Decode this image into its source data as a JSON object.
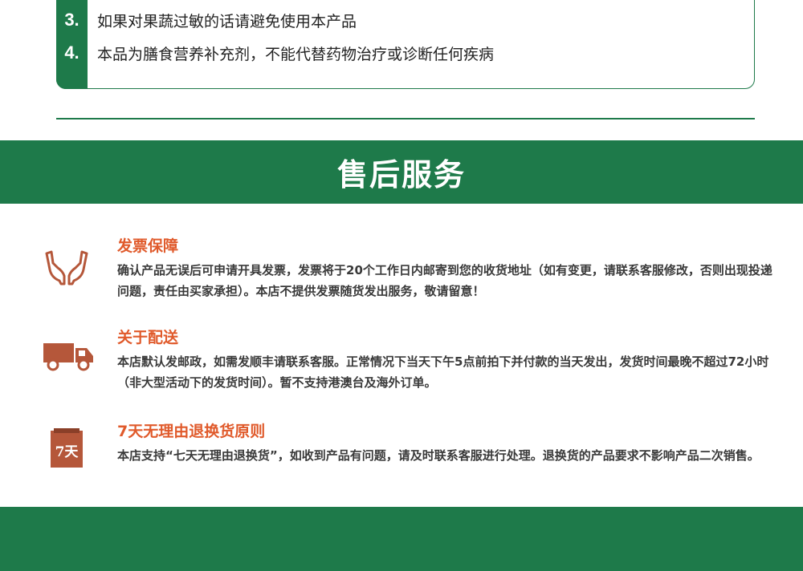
{
  "notice": {
    "items": [
      {
        "num": "3.",
        "text": "如果对果蔬过敏的话请避免使用本产品"
      },
      {
        "num": "4.",
        "text": "本品为膳食营养补充剂，不能代替药物治疗或诊断任何疾病"
      }
    ]
  },
  "banner": {
    "title": "售后服务"
  },
  "services": [
    {
      "title": "发票保障",
      "desc": "确认产品无误后可申请开具发票，发票将于20个工作日内邮寄到您的收货地址（如有变更，请联系客服修改，否则出现投递问题，责任由买家承担）。本店不提供发票随货发出服务，敬请留意！",
      "icon": "hands-icon"
    },
    {
      "title": "关于配送",
      "desc": "本店默认发邮政，如需发顺丰请联系客服。正常情况下当天下午5点前拍下并付款的当天发出，发货时间最晚不超过72小时（非大型活动下的发货时间）。暂不支持港澳台及海外订单。",
      "icon": "truck-icon"
    },
    {
      "title": "7天无理由退换货原则",
      "desc": "本店支持“七天无理由退换货”，如收到产品有问题，请及时联系客服进行处理。退换货的产品要求不影响产品二次销售。",
      "icon": "calendar-7-icon",
      "icon_text": "7天"
    }
  ],
  "colors": {
    "accent": "#1e7a4a",
    "title": "#e05a2b",
    "icon": "#b5573a"
  }
}
